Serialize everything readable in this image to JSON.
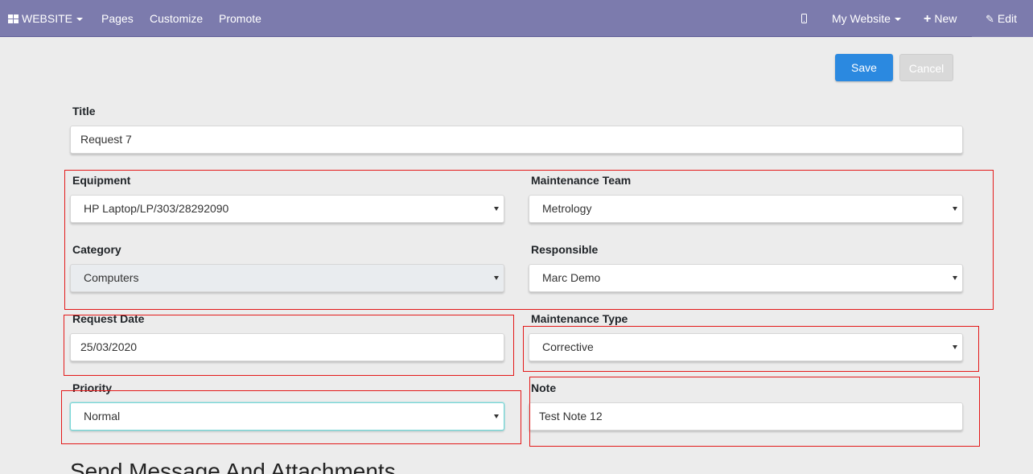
{
  "navbar": {
    "website_menu": "WEBSITE",
    "pages": "Pages",
    "customize": "Customize",
    "promote": "Promote",
    "my_website": "My Website",
    "new": "New",
    "edit": "Edit"
  },
  "actions": {
    "save": "Save",
    "cancel": "Cancel"
  },
  "form": {
    "title": {
      "label": "Title",
      "value": "Request 7"
    },
    "equipment": {
      "label": "Equipment",
      "value": "HP Laptop/LP/303/28292090"
    },
    "maintenance_team": {
      "label": "Maintenance Team",
      "value": "Metrology"
    },
    "category": {
      "label": "Category",
      "value": "Computers"
    },
    "responsible": {
      "label": "Responsible",
      "value": "Marc Demo"
    },
    "request_date": {
      "label": "Request Date",
      "value": "25/03/2020"
    },
    "maintenance_type": {
      "label": "Maintenance Type",
      "value": "Corrective"
    },
    "priority": {
      "label": "Priority",
      "value": "Normal"
    },
    "note": {
      "label": "Note",
      "value": "Test Note 12"
    }
  },
  "section_heading": "Send Message And Attachments",
  "colors": {
    "navbar": "#7c7bad",
    "primary": "#2b89e0",
    "highlight": "#e31919"
  }
}
